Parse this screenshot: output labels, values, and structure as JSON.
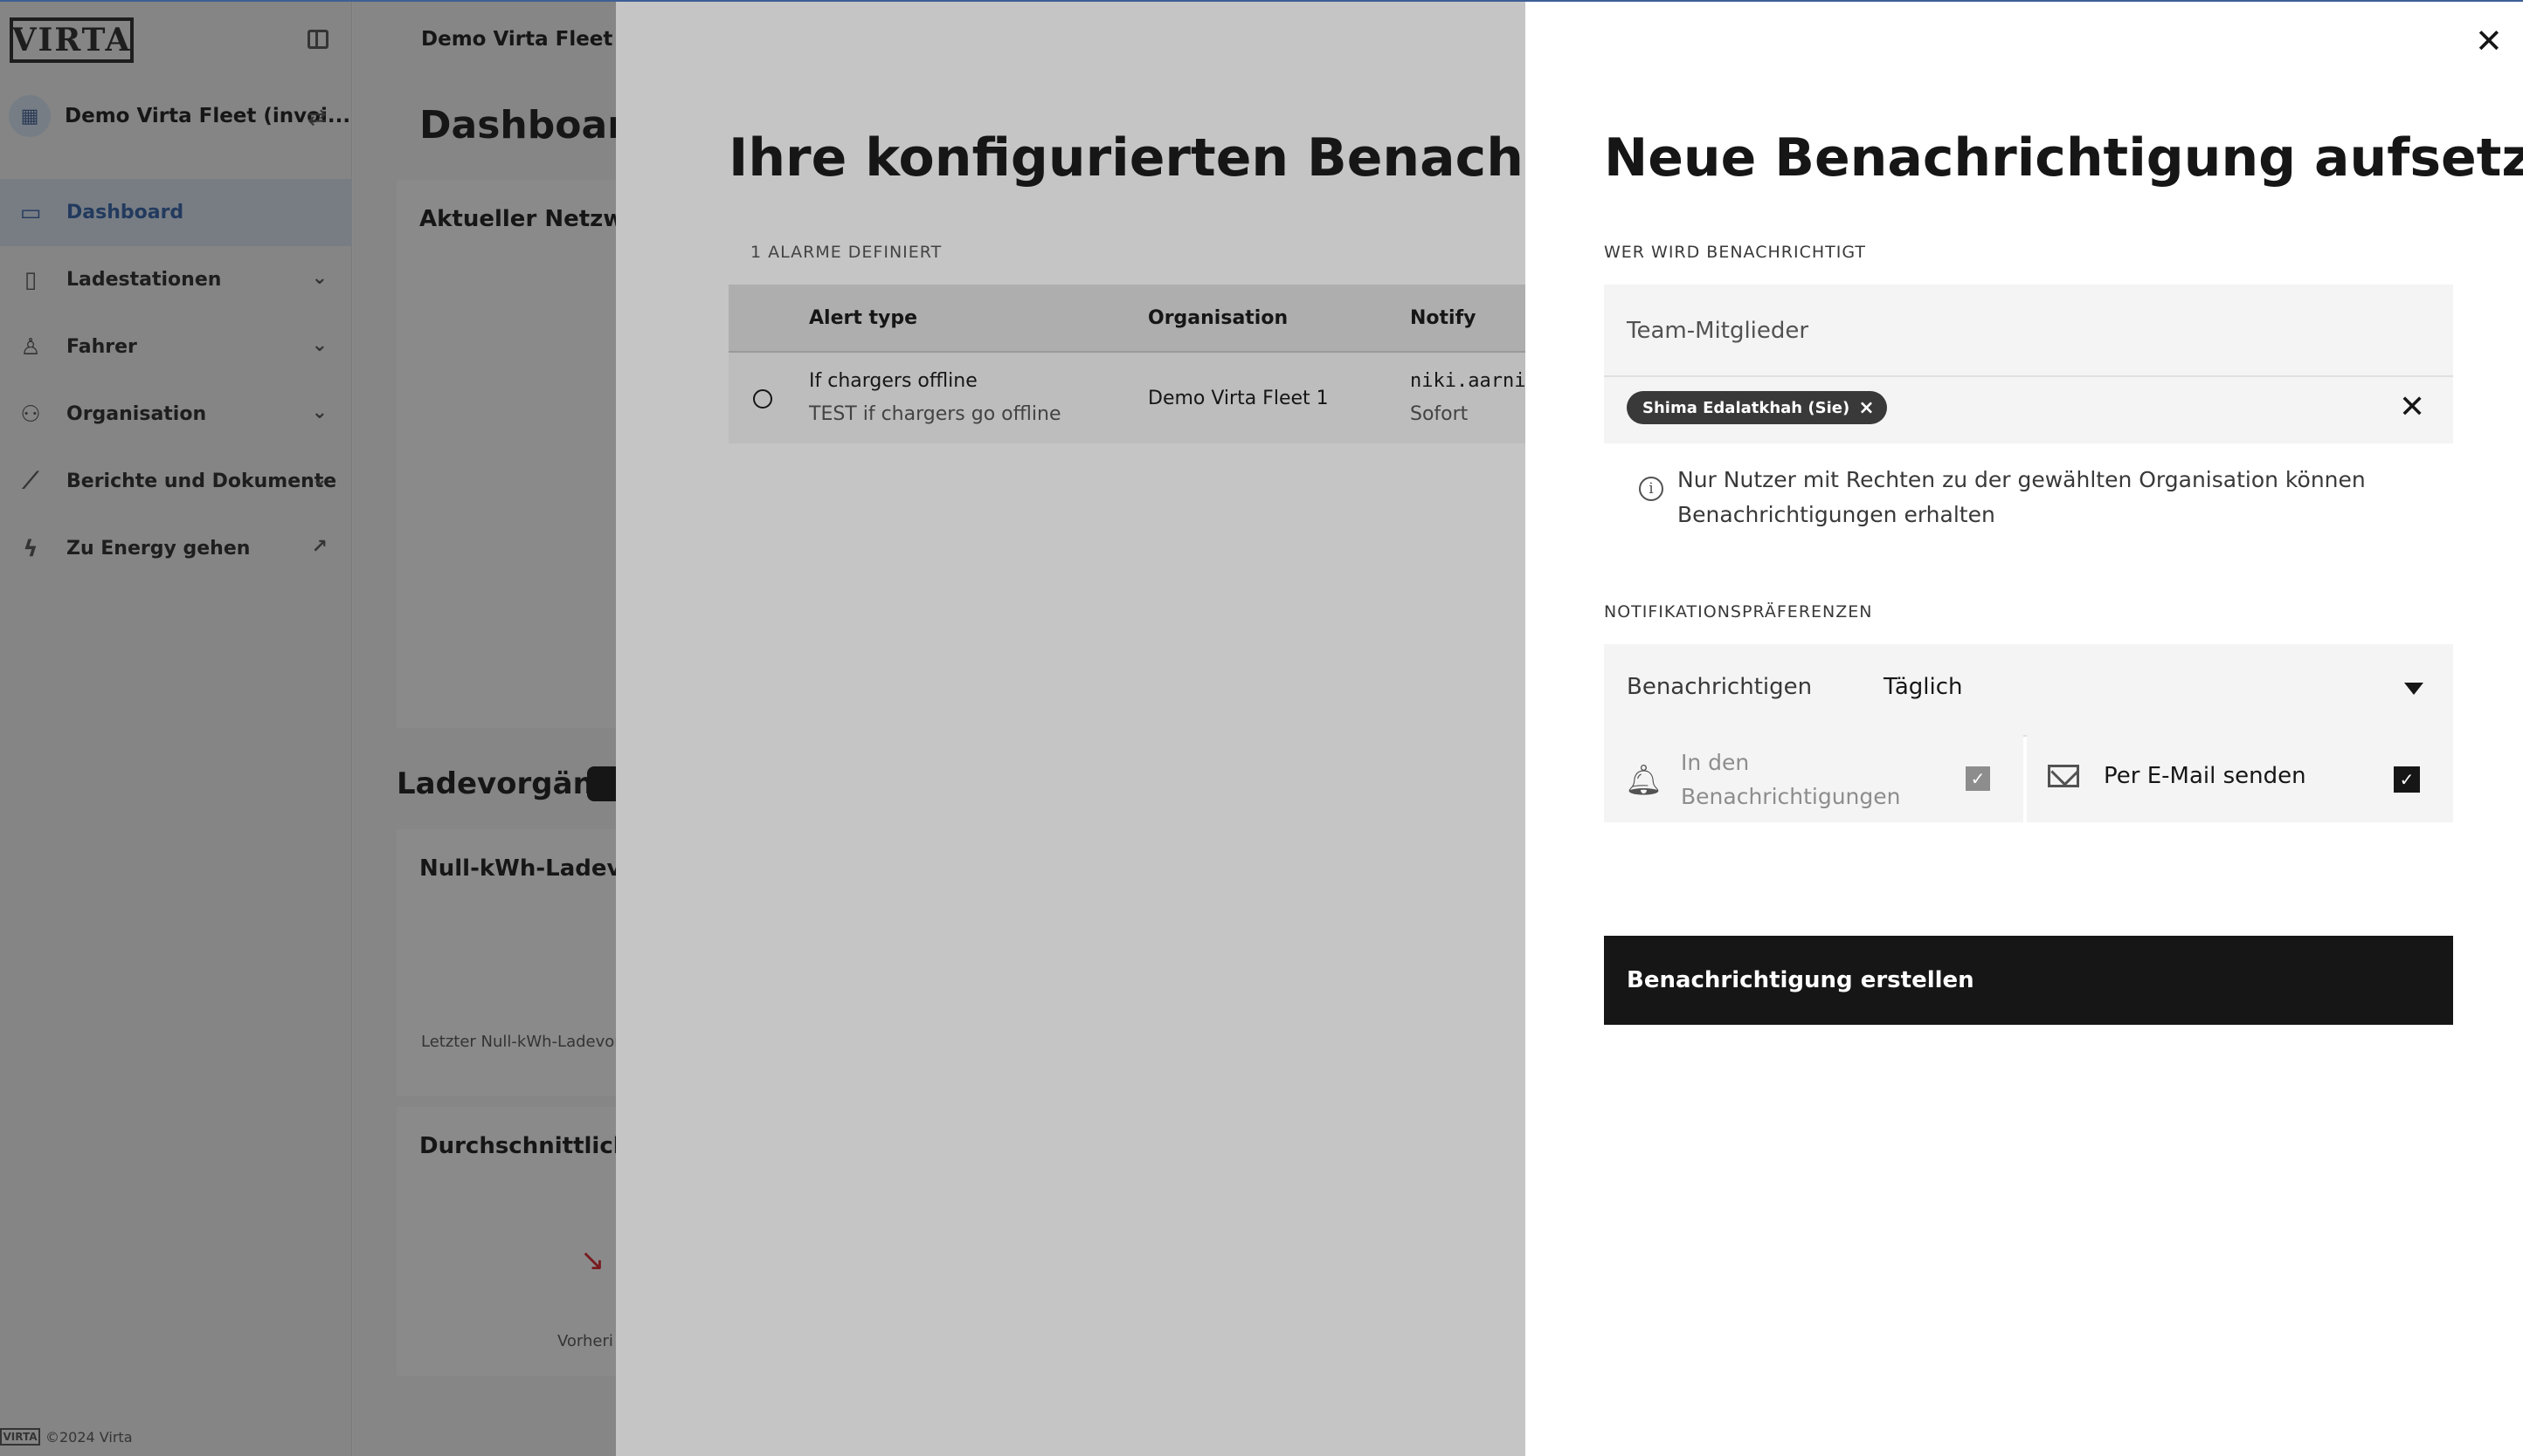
{
  "sidebar": {
    "logo": "VIRTA",
    "org_name": "Demo Virta Fleet (invoi...",
    "items": [
      {
        "label": "Dashboard",
        "icon": "presentation-board-icon"
      },
      {
        "label": "Ladestationen",
        "icon": "charging-station-icon"
      },
      {
        "label": "Fahrer",
        "icon": "driver-icon"
      },
      {
        "label": "Organisation",
        "icon": "organisation-icon"
      },
      {
        "label": "Berichte und Dokumente",
        "icon": "chart-line-icon"
      },
      {
        "label": "Zu Energy gehen",
        "icon": "lightning-icon"
      }
    ],
    "footer": "©2024 Virta"
  },
  "main": {
    "topbar_title": "Demo Virta Fleet (inv",
    "title": "Dashboard",
    "card_network": "Aktueller Netzwerk",
    "section_charging": "Ladevorgänge",
    "card_null_kwh": "Null-kWh-Ladevorg",
    "card_null_kwh_sub": "Letzter Null-kWh-Ladevor",
    "card_avg": "Durchschnittliche I",
    "card_avg_sub": "Vorheri"
  },
  "alerts_panel": {
    "title": "Ihre konfigurierten Benachrichtigu",
    "count_label": "1 ALARME DEFINIERT",
    "columns": [
      "Alert type",
      "Organisation",
      "Notify"
    ],
    "rows": [
      {
        "alert_type": "If chargers offline",
        "alert_desc": "TEST if chargers go offline",
        "organisation": "Demo Virta Fleet 1",
        "notify": "niki.aarni",
        "frequency": "Sofort"
      }
    ]
  },
  "drawer": {
    "title": "Neue Benachrichtigung aufsetzen",
    "who_label": "WER WIRD BENACHRICHTIGT",
    "team_placeholder": "Team-Mitglieder",
    "selected_member": "Shima Edalatkhah (Sie)",
    "info_text": "Nur Nutzer mit Rechten zu der gewählten Organisation können Benachrichtigungen erhalten",
    "prefs_label": "NOTIFIKATIONSPRÄFERENZEN",
    "notify_label": "Benachrichtigen",
    "notify_value": "Täglich",
    "channel_inapp": "In den Benachrichtigungen",
    "channel_email": "Per E-Mail senden",
    "create_button": "Benachrichtigung erstellen"
  }
}
